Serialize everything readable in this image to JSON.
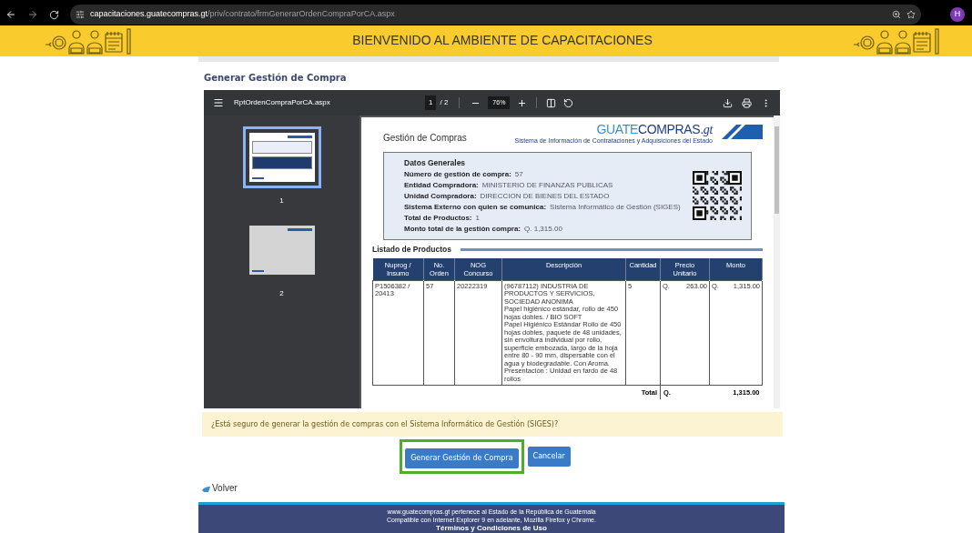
{
  "browser": {
    "url_host": "capacitaciones.guatecompras.gt",
    "url_path": "/priv/contrato/frmGenerarOrdenCompraPorCA.aspx",
    "profile_initial": "H"
  },
  "header": {
    "title": "BIENVENIDO AL AMBIENTE DE CAPACITACIONES"
  },
  "page_title": "Generar Gestión de Compra",
  "pdf_viewer": {
    "file_name": "RptOrdenCompraPorCA.aspx",
    "current_page": "1",
    "page_total": "/ 2",
    "zoom": "76%",
    "thumbnails": [
      {
        "label": "1",
        "selected": true
      },
      {
        "label": "2",
        "selected": false
      }
    ],
    "document": {
      "logo": {
        "part_1": "GUATE",
        "part_2": "COMPRAS.",
        "part_3": "gt",
        "tagline": "Sistema de Información de Contrataciones y Adquisiciones del Estado"
      },
      "heading": "Gestión de Compras",
      "general_data": {
        "title": "Datos Generales",
        "fields": [
          {
            "label": "Número de gestión de compra:",
            "value": "57"
          },
          {
            "label": "Entidad Compradora:",
            "value": "MINISTERIO DE FINANZAS PUBLICAS"
          },
          {
            "label": "Unidad Compradora:",
            "value": "DIRECCION DE BIENES DEL ESTADO"
          },
          {
            "label": "Sistema Externo con quien se comunica:",
            "value": "Sistema Informático de Gestión (SIGES)"
          },
          {
            "label": "Total de Productos:",
            "value": "1"
          },
          {
            "label": "Monto total de la gestión compra:",
            "value": "Q. 1,315.00"
          }
        ]
      },
      "products": {
        "title": "Listado de Productos",
        "columns": [
          "Nuprog / Insumo",
          "No. Orden",
          "NOG Concurso",
          "Descripción",
          "Cantidad",
          "Precio Unitario",
          "Monto"
        ],
        "rows": [
          {
            "insumo": "P1506382 / 20413",
            "order": "57",
            "nog": "20222319",
            "description": [
              "(96787112) INDUSTRIA DE PRODUCTOS Y SERVICIOS, SOCIEDAD ANONIMA",
              "Papel higiénico estándar, rollo de 450 hojas dobles. / BIO SOFT",
              "Papel Higiénico Estándar Rollo de 450 hojas dobles, paquete de 48 unidades, sin envoltura individual por rollo, superficie embozada, largo de la hoja entre 80 - 90 mm, dispersable con el agua y biodegradable. Con Aroma. Presentación : Unidad en fardo de 48 rollos"
            ],
            "quantity": "5",
            "unit_price": {
              "currency": "Q.",
              "amount": "263.00"
            },
            "amount": {
              "currency": "Q.",
              "amount": "1,315.00"
            }
          }
        ],
        "total": {
          "label": "Total",
          "currency": "Q.",
          "amount": "1,315.00"
        }
      }
    }
  },
  "confirmation": "¿Está seguro de generar la gestión de compras con el Sistema Informático de Gestión (SIGES)?",
  "buttons": [
    {
      "label": "Generar Gestión de Compra",
      "highlighted": true
    },
    {
      "label": "Cancelar",
      "highlighted": false
    }
  ],
  "back_link": "Volver",
  "footer": {
    "lines": [
      "www.guatecompras.gt pertenece al Estado de la República de Guatemala",
      "Compatible con Internet Explorer 9 en adelante, Mozilla Firefox y Chrome."
    ],
    "link": "Términos y Condiciones de Uso"
  }
}
